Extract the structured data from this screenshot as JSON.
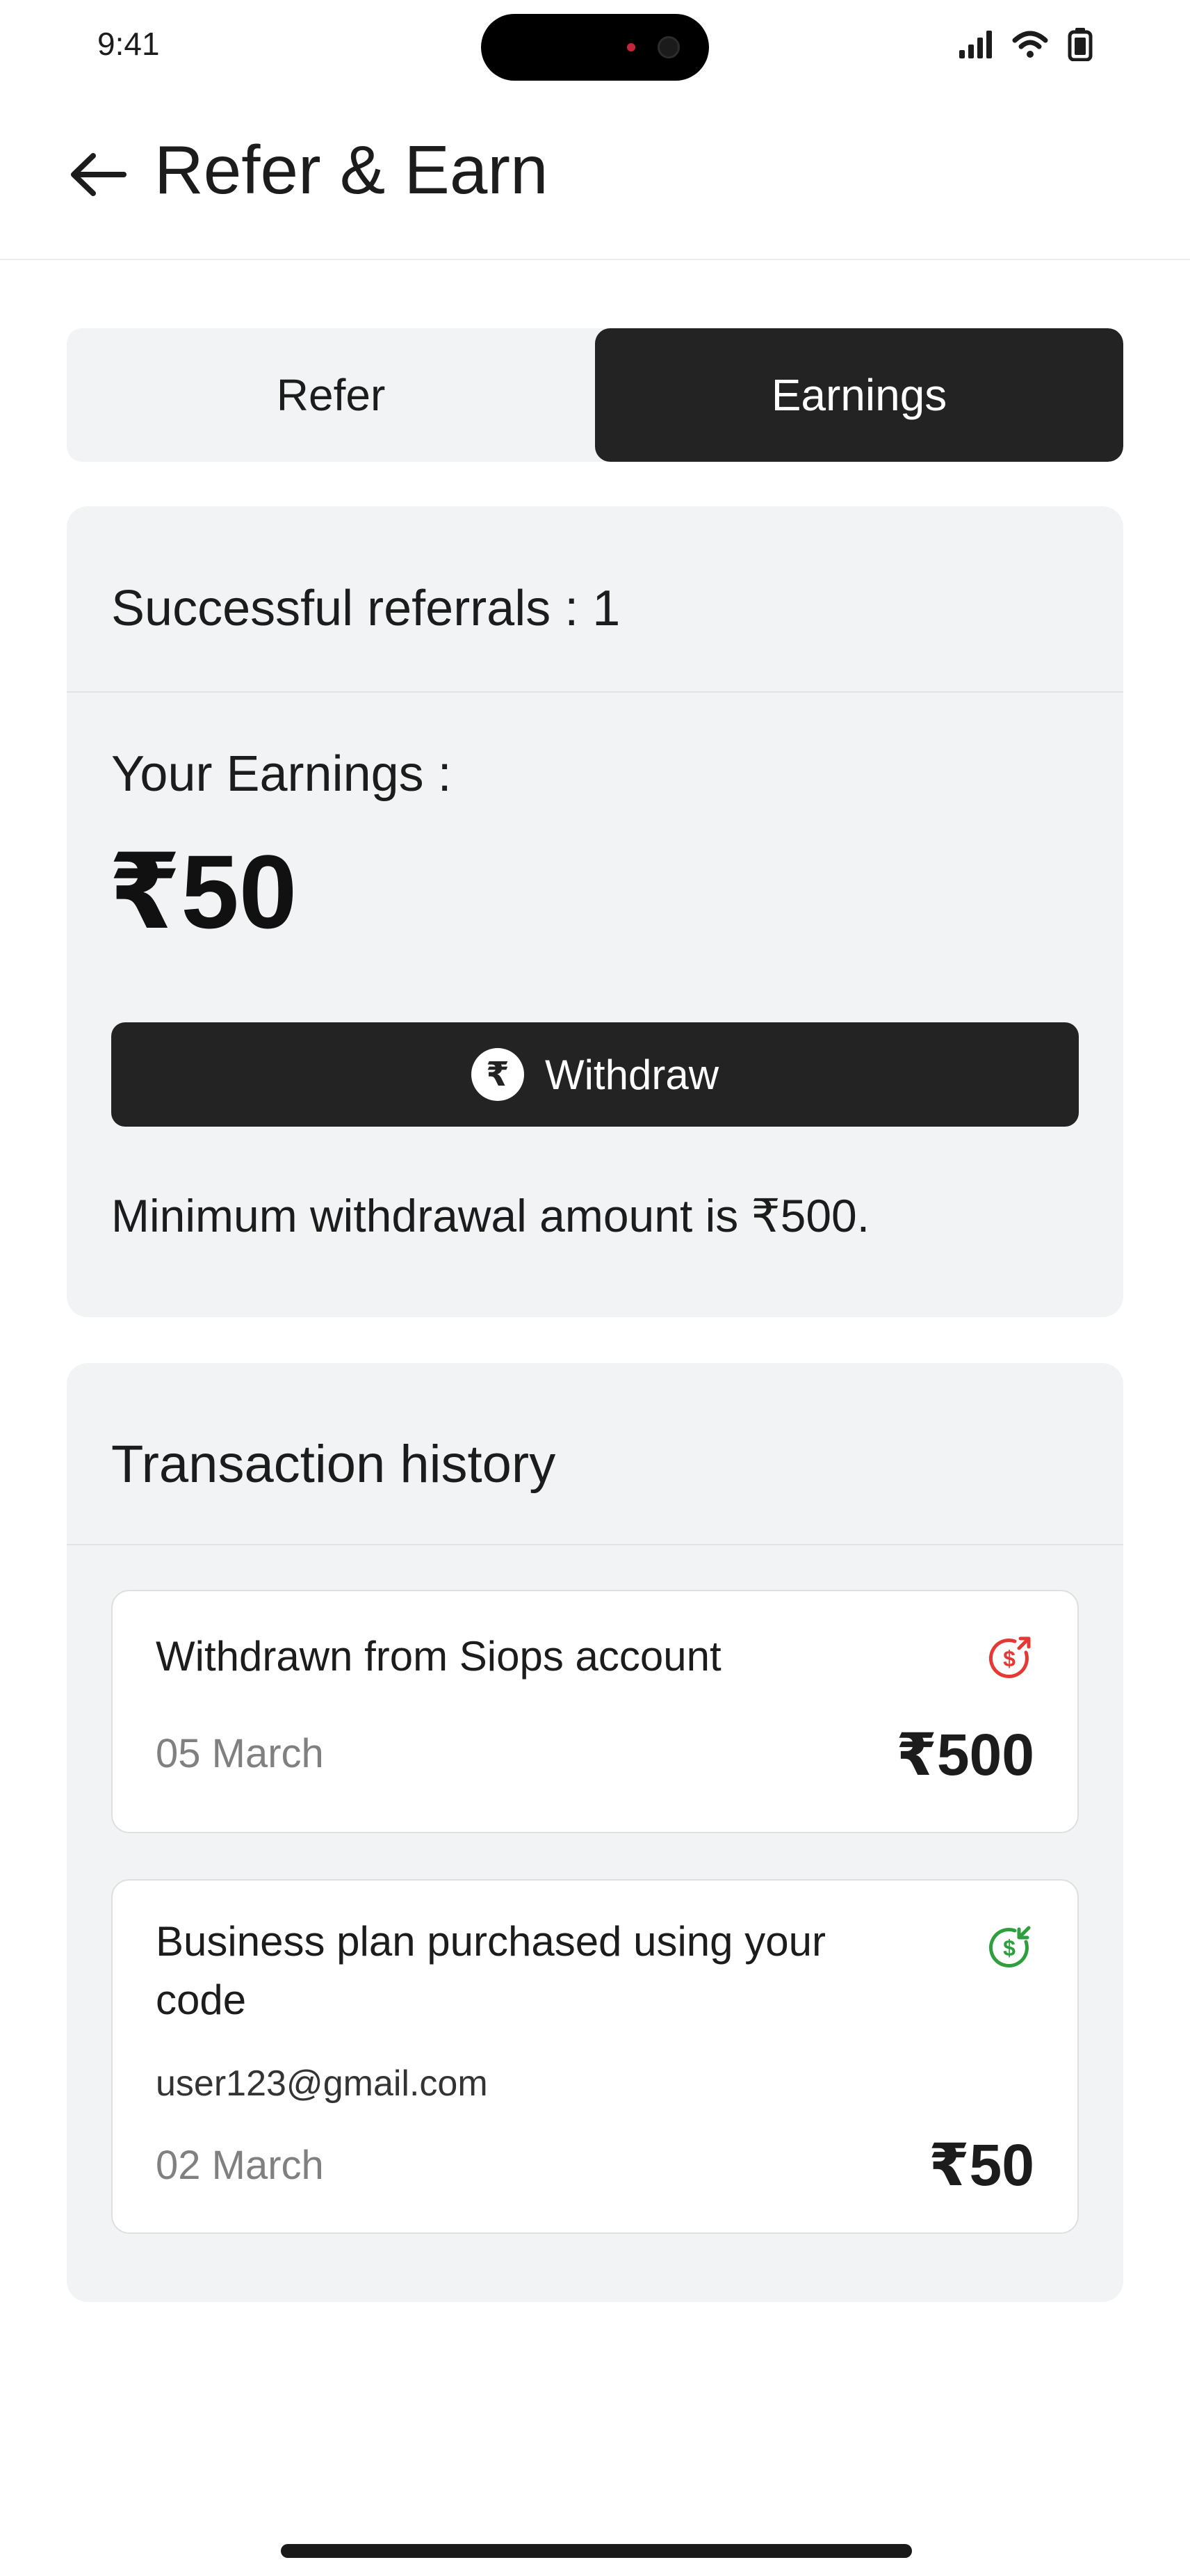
{
  "status_bar": {
    "time": "9:41",
    "icons": [
      "cellular-signal-icon",
      "wifi-icon",
      "battery-icon"
    ]
  },
  "header": {
    "back_icon": "arrow-left-icon",
    "title": "Refer & Earn"
  },
  "tabs": [
    {
      "label": "Refer",
      "active": false
    },
    {
      "label": "Earnings",
      "active": true
    }
  ],
  "earnings": {
    "referrals_text": "Successful referrals : 1",
    "label": "Your Earnings :",
    "amount": "₹50",
    "withdraw_label": "Withdraw",
    "withdraw_icon": "rupee-coin-icon",
    "min_note": "Minimum withdrawal amount is ₹500."
  },
  "history": {
    "title": "Transaction history",
    "transactions": [
      {
        "title": "Withdrawn from Siops account",
        "email": "",
        "date": "05 March",
        "amount": "₹500",
        "icon": "money-out-icon",
        "icon_color": "#e53935"
      },
      {
        "title": "Business plan purchased using your code",
        "email": "user123@gmail.com",
        "date": "02 March",
        "amount": "₹50",
        "icon": "money-in-icon",
        "icon_color": "#2e9e3e"
      }
    ]
  },
  "colors": {
    "dark": "#232323",
    "card_bg": "#f2f3f5",
    "muted_text": "#808080"
  }
}
